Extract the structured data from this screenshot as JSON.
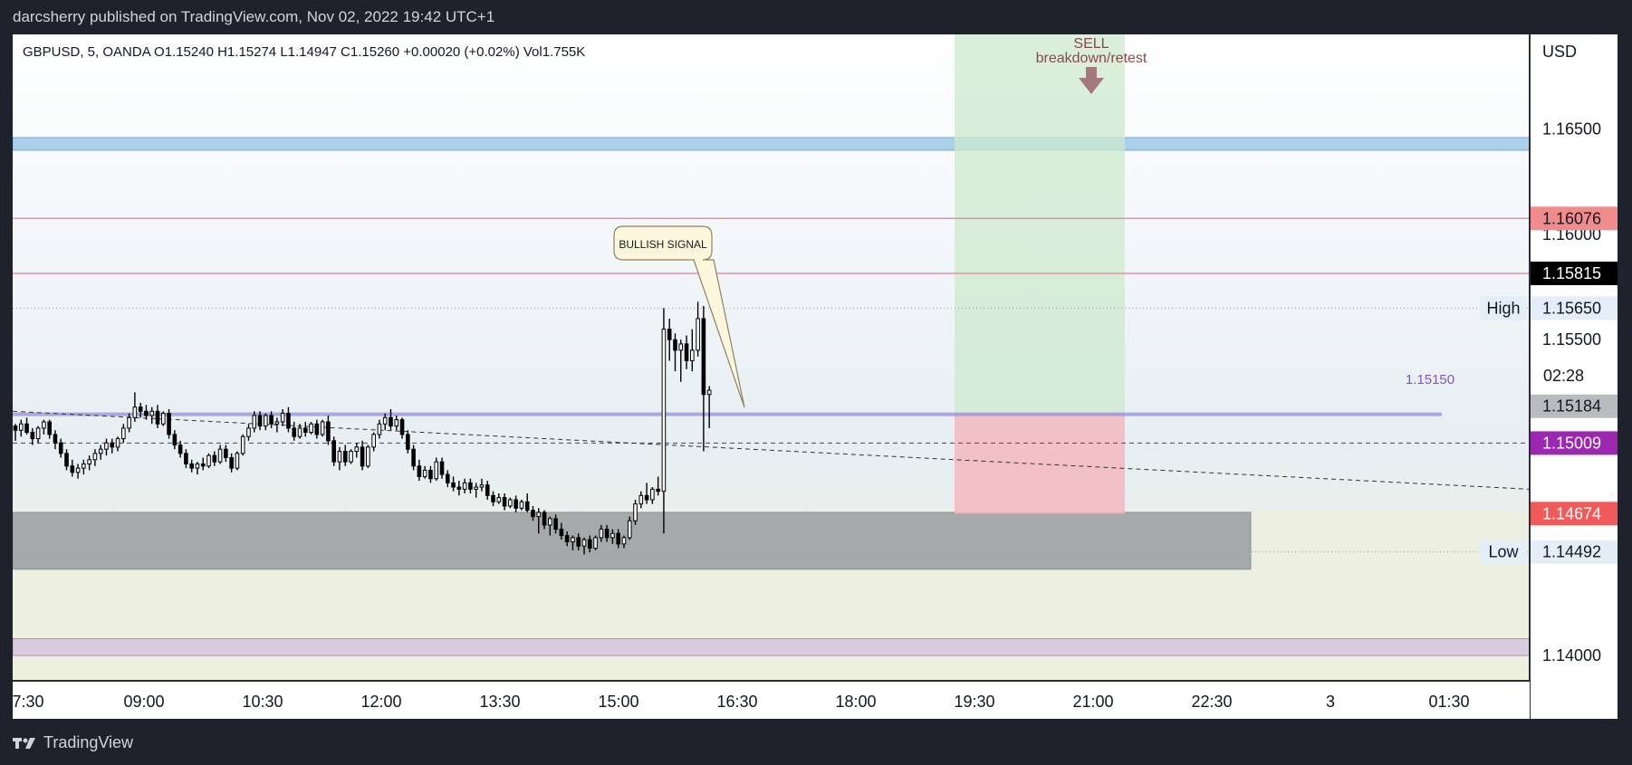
{
  "header": {
    "published": "darcsherry published on TradingView.com, Nov 02, 2022 19:42 UTC+1"
  },
  "footer": {
    "brand": "TradingView"
  },
  "ohlc": {
    "text": "GBPUSD, 5, OANDA  O1.15240  H1.15274  L1.14947  C1.15260  +0.00020 (+0.02%)  Vol1.755K"
  },
  "axis": {
    "currency": "USD",
    "countdown": "02:28"
  },
  "annotations": {
    "sell_title": "SELL",
    "sell_sub": "breakdown/retest",
    "bullish": "BULLISH SIGNAL",
    "level_1515": "1.15150",
    "high_label": "High",
    "low_label": "Low"
  },
  "colors": {
    "zone_blue": "#9fc8e8",
    "zone_purple": "#d8c9e0",
    "zone_gray": "#8a8f96",
    "line_pink": "#e391a8",
    "target_green": "#cdeacd",
    "stop_red": "#f2b8c0",
    "label_red": "#f28c8c",
    "label_purple": "#9c27b0",
    "sell_text": "#8a4a4a",
    "level_text": "#7e57c2"
  },
  "chart_data": {
    "type": "candlestick",
    "symbol": "GBPUSD",
    "interval": "5",
    "exchange": "OANDA",
    "ylim": [
      1.1388,
      1.1695
    ],
    "y_ticks": [
      1.165,
      1.16,
      1.155,
      1.14
    ],
    "x_ticks": [
      "7:30",
      "09:00",
      "10:30",
      "12:00",
      "13:30",
      "15:00",
      "16:30",
      "18:00",
      "19:30",
      "21:00",
      "22:30",
      "3",
      "01:30"
    ],
    "price_labels": [
      {
        "value": "1.16076",
        "price": 1.16076,
        "kind": "red"
      },
      {
        "value": "1.15815",
        "price": 1.15815,
        "kind": "black"
      },
      {
        "value": "1.15650",
        "price": 1.1565,
        "kind": "high"
      },
      {
        "value": "1.15184",
        "price": 1.15184,
        "kind": "gray"
      },
      {
        "value": "1.15009",
        "price": 1.15009,
        "kind": "purple"
      },
      {
        "value": "1.14674",
        "price": 1.14674,
        "kind": "redstrong"
      },
      {
        "value": "1.14492",
        "price": 1.14492,
        "kind": "low"
      }
    ],
    "zones": [
      {
        "name": "resistance-zone",
        "from": 1.164,
        "to": 1.1646
      },
      {
        "name": "support-zone",
        "from": 1.1441,
        "to": 1.1468
      },
      {
        "name": "lower-zone",
        "from": 1.14,
        "to": 1.1408
      }
    ],
    "levels": [
      1.16076,
      1.15815,
      1.1515
    ],
    "position": {
      "entry": 1.1515,
      "target": 1.1695,
      "stop": 1.14674
    },
    "candles": [
      [
        1.1509,
        1.151,
        1.1502,
        1.1507
      ],
      [
        1.1507,
        1.1512,
        1.1504,
        1.151
      ],
      [
        1.151,
        1.1513,
        1.1505,
        1.1506
      ],
      [
        1.1506,
        1.1508,
        1.15,
        1.1503
      ],
      [
        1.1503,
        1.1509,
        1.1501,
        1.1508
      ],
      [
        1.1508,
        1.1512,
        1.1505,
        1.1511
      ],
      [
        1.1511,
        1.1512,
        1.1503,
        1.1505
      ],
      [
        1.1505,
        1.1507,
        1.1498,
        1.1501
      ],
      [
        1.1501,
        1.1503,
        1.1494,
        1.1496
      ],
      [
        1.1496,
        1.1498,
        1.1488,
        1.149
      ],
      [
        1.149,
        1.1493,
        1.1485,
        1.1487
      ],
      [
        1.1487,
        1.1491,
        1.1484,
        1.1489
      ],
      [
        1.1489,
        1.1493,
        1.1486,
        1.1491
      ],
      [
        1.1491,
        1.1495,
        1.1488,
        1.1493
      ],
      [
        1.1493,
        1.1498,
        1.149,
        1.1496
      ],
      [
        1.1496,
        1.15,
        1.1493,
        1.1498
      ],
      [
        1.1498,
        1.1503,
        1.1495,
        1.1501
      ],
      [
        1.1501,
        1.1503,
        1.1496,
        1.1499
      ],
      [
        1.1499,
        1.1504,
        1.1497,
        1.1503
      ],
      [
        1.1503,
        1.151,
        1.1501,
        1.1508
      ],
      [
        1.1508,
        1.1515,
        1.1506,
        1.1513
      ],
      [
        1.1513,
        1.1525,
        1.1511,
        1.1518
      ],
      [
        1.1518,
        1.152,
        1.1513,
        1.1516
      ],
      [
        1.1516,
        1.1519,
        1.1512,
        1.1514
      ],
      [
        1.1514,
        1.1518,
        1.151,
        1.1516
      ],
      [
        1.1516,
        1.1519,
        1.1508,
        1.151
      ],
      [
        1.151,
        1.1516,
        1.1509,
        1.1515
      ],
      [
        1.1515,
        1.1517,
        1.1503,
        1.1505
      ],
      [
        1.1505,
        1.1507,
        1.1498,
        1.15
      ],
      [
        1.15,
        1.1502,
        1.1494,
        1.1496
      ],
      [
        1.1496,
        1.1498,
        1.1489,
        1.1491
      ],
      [
        1.1491,
        1.1493,
        1.1487,
        1.1489
      ],
      [
        1.1489,
        1.1492,
        1.1486,
        1.1491
      ],
      [
        1.1491,
        1.1494,
        1.1488,
        1.149
      ],
      [
        1.149,
        1.1496,
        1.1489,
        1.1495
      ],
      [
        1.1495,
        1.1497,
        1.149,
        1.1492
      ],
      [
        1.1492,
        1.15,
        1.1491,
        1.1498
      ],
      [
        1.1498,
        1.15,
        1.1492,
        1.1494
      ],
      [
        1.1494,
        1.1496,
        1.1487,
        1.1489
      ],
      [
        1.1489,
        1.1497,
        1.1488,
        1.1496
      ],
      [
        1.1496,
        1.1505,
        1.1495,
        1.1504
      ],
      [
        1.1504,
        1.151,
        1.1502,
        1.1508
      ],
      [
        1.1508,
        1.1516,
        1.1506,
        1.1514
      ],
      [
        1.1514,
        1.1516,
        1.1507,
        1.1509
      ],
      [
        1.1509,
        1.1515,
        1.1507,
        1.1514
      ],
      [
        1.1514,
        1.1516,
        1.1508,
        1.151
      ],
      [
        1.151,
        1.1513,
        1.1506,
        1.1511
      ],
      [
        1.1511,
        1.1517,
        1.1509,
        1.1515
      ],
      [
        1.1515,
        1.1518,
        1.1506,
        1.1508
      ],
      [
        1.1508,
        1.1511,
        1.1502,
        1.1504
      ],
      [
        1.1504,
        1.151,
        1.1503,
        1.1508
      ],
      [
        1.1508,
        1.1511,
        1.1504,
        1.1506
      ],
      [
        1.1506,
        1.1511,
        1.1505,
        1.151
      ],
      [
        1.151,
        1.1512,
        1.1503,
        1.1505
      ],
      [
        1.1505,
        1.1512,
        1.1504,
        1.1511
      ],
      [
        1.1511,
        1.1514,
        1.15,
        1.1502
      ],
      [
        1.1502,
        1.1504,
        1.149,
        1.1492
      ],
      [
        1.1492,
        1.1499,
        1.1488,
        1.1497
      ],
      [
        1.1497,
        1.15,
        1.149,
        1.1492
      ],
      [
        1.1492,
        1.1498,
        1.1491,
        1.1497
      ],
      [
        1.1497,
        1.1501,
        1.1494,
        1.1499
      ],
      [
        1.1499,
        1.1502,
        1.1488,
        1.149
      ],
      [
        1.149,
        1.15,
        1.1489,
        1.1499
      ],
      [
        1.1499,
        1.1506,
        1.1497,
        1.1505
      ],
      [
        1.1505,
        1.1512,
        1.1503,
        1.151
      ],
      [
        1.151,
        1.1515,
        1.1507,
        1.1513
      ],
      [
        1.1513,
        1.1517,
        1.1507,
        1.1509
      ],
      [
        1.1509,
        1.1514,
        1.1507,
        1.1512
      ],
      [
        1.1512,
        1.1513,
        1.1503,
        1.1505
      ],
      [
        1.1505,
        1.1507,
        1.1496,
        1.1498
      ],
      [
        1.1498,
        1.15,
        1.1488,
        1.149
      ],
      [
        1.149,
        1.1493,
        1.1483,
        1.1485
      ],
      [
        1.1485,
        1.149,
        1.1484,
        1.1488
      ],
      [
        1.1488,
        1.149,
        1.1482,
        1.1484
      ],
      [
        1.1484,
        1.1494,
        1.1483,
        1.1492
      ],
      [
        1.1492,
        1.1494,
        1.1484,
        1.1486
      ],
      [
        1.1486,
        1.1488,
        1.148,
        1.1482
      ],
      [
        1.1482,
        1.1485,
        1.1478,
        1.148
      ],
      [
        1.148,
        1.1483,
        1.1476,
        1.1479
      ],
      [
        1.1479,
        1.1484,
        1.1477,
        1.1482
      ],
      [
        1.1482,
        1.1484,
        1.1477,
        1.1479
      ],
      [
        1.1479,
        1.1482,
        1.1475,
        1.148
      ],
      [
        1.148,
        1.1484,
        1.1478,
        1.1481
      ],
      [
        1.1481,
        1.1483,
        1.1474,
        1.1476
      ],
      [
        1.1476,
        1.1478,
        1.1471,
        1.1473
      ],
      [
        1.1473,
        1.1477,
        1.1472,
        1.1475
      ],
      [
        1.1475,
        1.1477,
        1.1469,
        1.1471
      ],
      [
        1.1471,
        1.1475,
        1.147,
        1.1474
      ],
      [
        1.1474,
        1.1476,
        1.1468,
        1.147
      ],
      [
        1.147,
        1.1474,
        1.1469,
        1.1473
      ],
      [
        1.1473,
        1.1477,
        1.1468,
        1.1469
      ],
      [
        1.1469,
        1.1471,
        1.1464,
        1.1466
      ],
      [
        1.1466,
        1.147,
        1.1458,
        1.1468
      ],
      [
        1.1468,
        1.1469,
        1.146,
        1.1462
      ],
      [
        1.1462,
        1.1466,
        1.1457,
        1.1465
      ],
      [
        1.1465,
        1.1467,
        1.1458,
        1.146
      ],
      [
        1.146,
        1.1463,
        1.1455,
        1.1457
      ],
      [
        1.1457,
        1.1459,
        1.1452,
        1.1454
      ],
      [
        1.1454,
        1.1457,
        1.145,
        1.1456
      ],
      [
        1.1456,
        1.1458,
        1.145,
        1.1452
      ],
      [
        1.1452,
        1.1456,
        1.1448,
        1.1455
      ],
      [
        1.1455,
        1.1457,
        1.1449,
        1.1451
      ],
      [
        1.1451,
        1.1457,
        1.145,
        1.1456
      ],
      [
        1.1456,
        1.1462,
        1.1454,
        1.146
      ],
      [
        1.146,
        1.1462,
        1.1454,
        1.1456
      ],
      [
        1.1456,
        1.146,
        1.1453,
        1.1458
      ],
      [
        1.1458,
        1.146,
        1.1451,
        1.1453
      ],
      [
        1.1453,
        1.1457,
        1.1451,
        1.1456
      ],
      [
        1.1456,
        1.1466,
        1.1455,
        1.1464
      ],
      [
        1.1464,
        1.1474,
        1.1462,
        1.1472
      ],
      [
        1.1472,
        1.1478,
        1.147,
        1.1476
      ],
      [
        1.1476,
        1.1482,
        1.1472,
        1.1474
      ],
      [
        1.1474,
        1.148,
        1.1472,
        1.1479
      ],
      [
        1.1479,
        1.1485,
        1.1476,
        1.1478
      ],
      [
        1.1478,
        1.1565,
        1.1458,
        1.1555
      ],
      [
        1.1555,
        1.156,
        1.154,
        1.155
      ],
      [
        1.155,
        1.1553,
        1.1535,
        1.1545
      ],
      [
        1.1545,
        1.155,
        1.153,
        1.1548
      ],
      [
        1.1548,
        1.1552,
        1.1536,
        1.154
      ],
      [
        1.154,
        1.1555,
        1.1535,
        1.1545
      ],
      [
        1.1545,
        1.1568,
        1.1542,
        1.156
      ],
      [
        1.156,
        1.1566,
        1.1497,
        1.1524
      ],
      [
        1.1524,
        1.1528,
        1.1508,
        1.1526
      ]
    ]
  }
}
